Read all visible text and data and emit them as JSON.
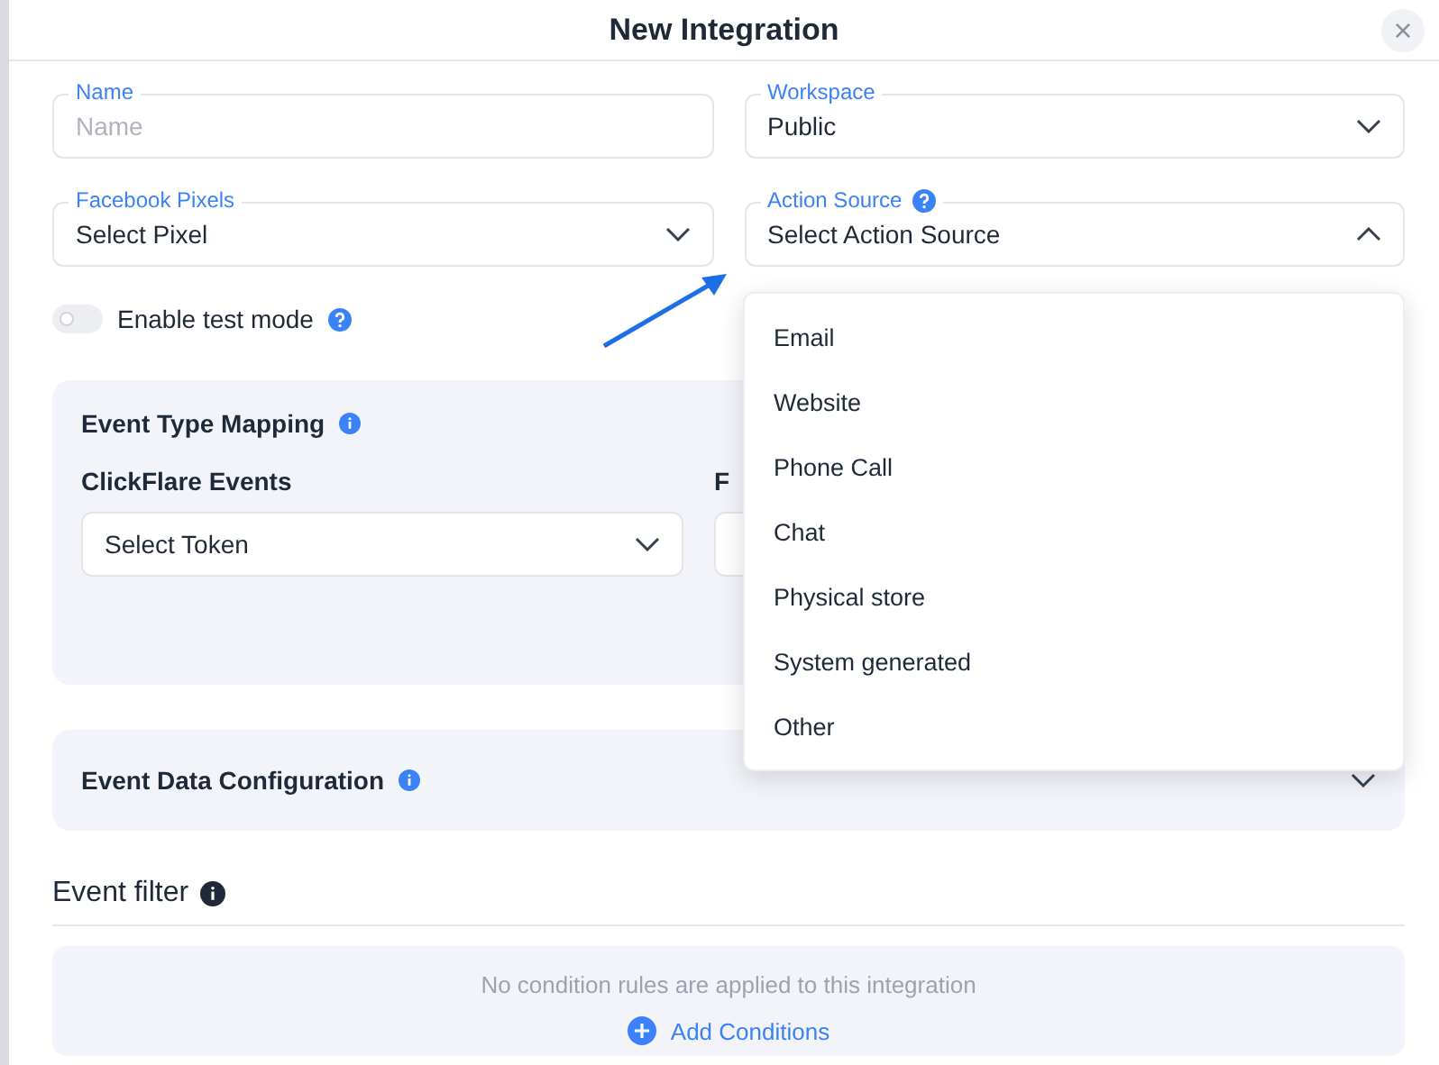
{
  "modal": {
    "title": "New Integration",
    "close": "×"
  },
  "fields": [
    {
      "label": "Name",
      "placeholder": "Name",
      "kind": "input"
    },
    {
      "label": "Workspace",
      "value": "Public",
      "kind": "select",
      "expanded": false
    },
    {
      "label": "Facebook Pixels",
      "value": "Select Pixel",
      "kind": "select",
      "expanded": false
    },
    {
      "label": "Action Source",
      "value": "Select Action Source",
      "kind": "select",
      "expanded": true,
      "help": true
    }
  ],
  "action_source_options": [
    "Email",
    "Website",
    "Phone Call",
    "Chat",
    "Physical store",
    "System generated",
    "Other"
  ],
  "test_mode": {
    "label": "Enable test mode",
    "on": false
  },
  "event_type_mapping": {
    "title": "Event Type Mapping",
    "columns": [
      {
        "label": "ClickFlare Events",
        "value": "Select Token"
      },
      {
        "label": "F"
      }
    ]
  },
  "event_data_configuration": {
    "title": "Event Data Configuration",
    "expanded": false
  },
  "event_filter": {
    "title": "Event filter",
    "empty_message": "No condition rules are applied to this integration",
    "add_button": "Add Conditions"
  }
}
